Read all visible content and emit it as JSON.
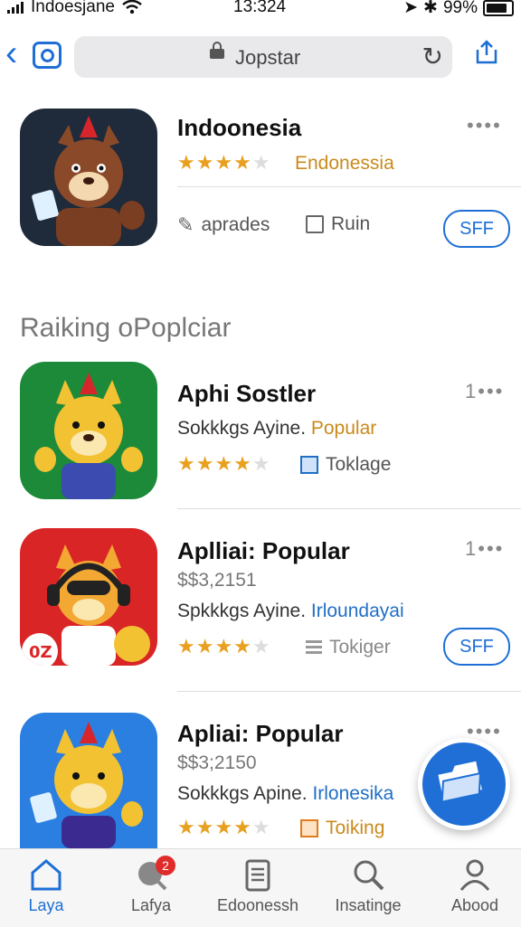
{
  "status_bar": {
    "carrier": "Indoesjane",
    "time": "13:324",
    "battery": "99%"
  },
  "browser": {
    "url": "Jopstar"
  },
  "featured": {
    "title": "Indoonesia",
    "category": "Endonessia",
    "rating": 4,
    "action1": "aprades",
    "action2": "Ruin",
    "button": "SFF"
  },
  "section_title": "Raiking oPoplciar",
  "apps": [
    {
      "title": "Aphi Sostler",
      "rank": "1",
      "subtitle": "Sokkkgs Ayine.",
      "tag": "Popular",
      "rating": 4,
      "meta": "Toklage",
      "button": ""
    },
    {
      "title": "Aplliai: Popular",
      "rank": "1",
      "price": "$$3,2151",
      "subtitle": "Spkkkgs Ayine.",
      "tag": "Irloundayai",
      "rating": 4,
      "meta": "Tokiger",
      "button": "SFF"
    },
    {
      "title": "Apliai: Popular",
      "rank": "",
      "price": "$$3;2150",
      "subtitle": "Sokkkgs Apine.",
      "tag": "Irlonesika",
      "rating": 4,
      "meta": "Toiking",
      "button": ""
    }
  ],
  "tabs": [
    {
      "label": "Laya"
    },
    {
      "label": "Lafya"
    },
    {
      "label": "Edoonessh"
    },
    {
      "label": "Insatinge"
    },
    {
      "label": "Abood"
    }
  ],
  "badge_count": "2",
  "colors": {
    "accent": "#1d6fd6",
    "star": "#e8a020",
    "tag_orange": "#c98a1c"
  }
}
